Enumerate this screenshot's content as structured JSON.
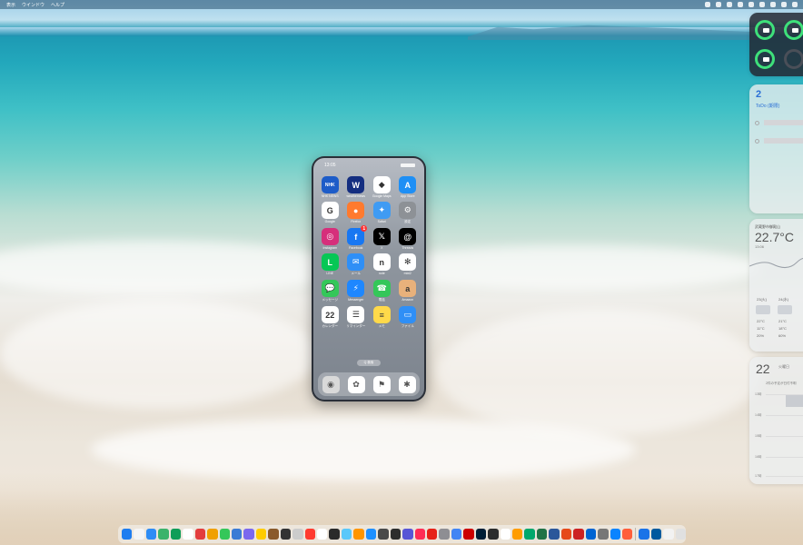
{
  "menubar": {
    "items": [
      "表示",
      "ウインドウ",
      "ヘルプ"
    ],
    "status_icons": [
      "stopwatch-icon",
      "cloud-icon",
      "location-icon",
      "screen-icon",
      "airplay-icon",
      "bluetooth-icon",
      "clock-icon",
      "wifi-icon",
      "control-center-icon"
    ]
  },
  "phone": {
    "time": "13:05",
    "apps": [
      {
        "label": "NHK NEWS",
        "icon": "nhk-news-icon",
        "color": "#1d5cc8",
        "glyph": "NHK"
      },
      {
        "label": "weathernews",
        "icon": "weathernews-icon",
        "color": "#142e80",
        "glyph": "W"
      },
      {
        "label": "Google Maps",
        "icon": "google-maps-icon",
        "color": "#ffffff",
        "glyph": "◆"
      },
      {
        "label": "App Store",
        "icon": "app-store-icon",
        "color": "#1e8ff5",
        "glyph": "A"
      },
      {
        "label": "Google",
        "icon": "google-icon",
        "color": "#ffffff",
        "glyph": "G"
      },
      {
        "label": "Firefox",
        "icon": "firefox-icon",
        "color": "#ff7a2e",
        "glyph": "●"
      },
      {
        "label": "Safari",
        "icon": "safari-icon",
        "color": "#3f9bf3",
        "glyph": "✦"
      },
      {
        "label": "設定",
        "icon": "settings-icon",
        "color": "#8d9196",
        "glyph": "⚙"
      },
      {
        "label": "Instagram",
        "icon": "instagram-icon",
        "color": "#d62f7b",
        "glyph": "◎"
      },
      {
        "label": "Facebook",
        "icon": "facebook-icon",
        "color": "#1877f2",
        "glyph": "f",
        "badge": "1"
      },
      {
        "label": "X",
        "icon": "x-icon",
        "color": "#000000",
        "glyph": "𝕏"
      },
      {
        "label": "Threads",
        "icon": "threads-icon",
        "color": "#000000",
        "glyph": "@"
      },
      {
        "label": "LINE",
        "icon": "line-icon",
        "color": "#06c755",
        "glyph": "L"
      },
      {
        "label": "メール",
        "icon": "mail-icon",
        "color": "#2f8ff6",
        "glyph": "✉"
      },
      {
        "label": "note",
        "icon": "note-icon",
        "color": "#ffffff",
        "glyph": "n"
      },
      {
        "label": "mixi2",
        "icon": "mixi2-icon",
        "color": "#ffffff",
        "glyph": "✻"
      },
      {
        "label": "メッセージ",
        "icon": "messages-icon",
        "color": "#34c759",
        "glyph": "💬"
      },
      {
        "label": "Messenger",
        "icon": "messenger-icon",
        "color": "#1e87ff",
        "glyph": "⚡"
      },
      {
        "label": "電話",
        "icon": "phone-icon",
        "color": "#34c759",
        "glyph": "☎"
      },
      {
        "label": "Amazon",
        "icon": "amazon-icon",
        "color": "#e8b17b",
        "glyph": "a"
      },
      {
        "label": "カレンダー",
        "icon": "calendar-icon",
        "color": "#ffffff",
        "glyph": "22"
      },
      {
        "label": "リマインダー",
        "icon": "reminders-icon",
        "color": "#ffffff",
        "glyph": "☰"
      },
      {
        "label": "メモ",
        "icon": "notes-icon",
        "color": "#ffd94a",
        "glyph": "≡"
      },
      {
        "label": "ファイル",
        "icon": "files-icon",
        "color": "#2f8ff6",
        "glyph": "▭"
      }
    ],
    "search_label": "Q 検索",
    "dock": [
      {
        "icon": "camera-icon",
        "color": "#d9d9d9",
        "glyph": "◉"
      },
      {
        "icon": "photos-icon",
        "color": "#ffffff",
        "glyph": "✿"
      },
      {
        "icon": "family-icon",
        "color": "#ffffff",
        "glyph": "⚑"
      },
      {
        "icon": "photos-flower-icon",
        "color": "#ffffff",
        "glyph": "✱"
      }
    ]
  },
  "widgets": {
    "todo": {
      "count": "2",
      "title": "ToDo (期限)"
    },
    "weather": {
      "location": "武蔵野市御殿山",
      "temp": "22.7°C",
      "time": "13:06",
      "rows": [
        {
          "day": "23(火)",
          "hi": "22°C",
          "lo": "11°C",
          "pct": "20%"
        },
        {
          "day": "24(水)",
          "hi": "21°C",
          "lo": "18°C",
          "pct": "60%"
        }
      ]
    },
    "calendar": {
      "day": "22",
      "dow": "火曜日",
      "note": "2件の予定が日付不明",
      "hours": [
        "13時",
        "14時",
        "15時",
        "16時",
        "17時"
      ]
    }
  },
  "dock_colors": [
    "#1e7df0",
    "#f5f5f5",
    "#2d8cf5",
    "#3bb36b",
    "#0f9d58",
    "#ffffff",
    "#e33d3d",
    "#f0a000",
    "#34c759",
    "#3a7bd5",
    "#7b68ee",
    "#ffcc00",
    "#8a5a2b",
    "#333333",
    "#cccccc",
    "#ff3b30",
    "#ffffff",
    "#2a2a2a",
    "#5ac8fa",
    "#ff9500",
    "#1e90ff",
    "#4a4a4a",
    "#2d2d2d",
    "#5856d6",
    "#ff2d55",
    "#e62117",
    "#8e8e93",
    "#4285f4",
    "#cc0000",
    "#001e36",
    "#2c2c2c",
    "#ffffff",
    "#ff9d00",
    "#00a86b",
    "#217346",
    "#2b579a",
    "#e64a19",
    "#cc2222",
    "#0064d2",
    "#777777",
    "#0a84ff",
    "#ff5e3a",
    "#1a73e8",
    "#005a9e",
    "#f2f2f2",
    "#e0e0e0"
  ]
}
